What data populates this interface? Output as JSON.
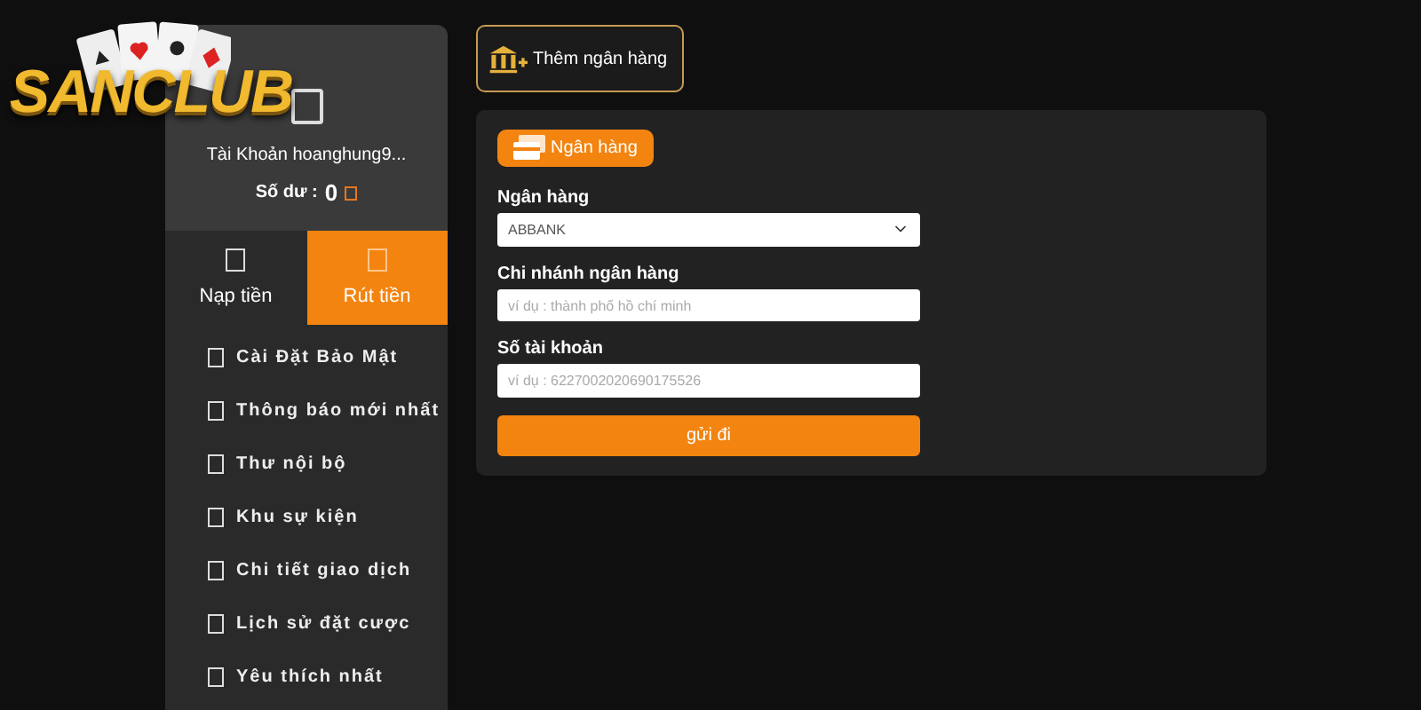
{
  "logo": {
    "text": "SANCLUB"
  },
  "account": {
    "name": "Tài Khoản hoanghung9...",
    "balance_label": "Số dư :",
    "balance": "0"
  },
  "tabs": [
    {
      "label": "Nạp tiền",
      "selected": false
    },
    {
      "label": "Rút tiền",
      "selected": true
    }
  ],
  "menu": [
    "Cài Đặt Bảo Mật",
    "Thông báo mới nhất",
    "Thư nội bộ",
    "Khu sự kiện",
    "Chi tiết giao dịch",
    "Lịch sử đặt cược",
    "Yêu thích nhất"
  ],
  "add_bank_button": "Thêm ngân hàng",
  "form": {
    "tab": "Ngân hàng",
    "fields": [
      {
        "kind": "select",
        "label": "Ngân hàng",
        "value": "ABBANK"
      },
      {
        "kind": "input",
        "label": "Chi nhánh ngân hàng",
        "placeholder": "ví dụ : thành phố hồ chí minh"
      },
      {
        "kind": "input",
        "label": "Số tài khoản",
        "placeholder": "ví dụ : 6227002020690175526"
      }
    ],
    "submit": "gửi đi"
  }
}
